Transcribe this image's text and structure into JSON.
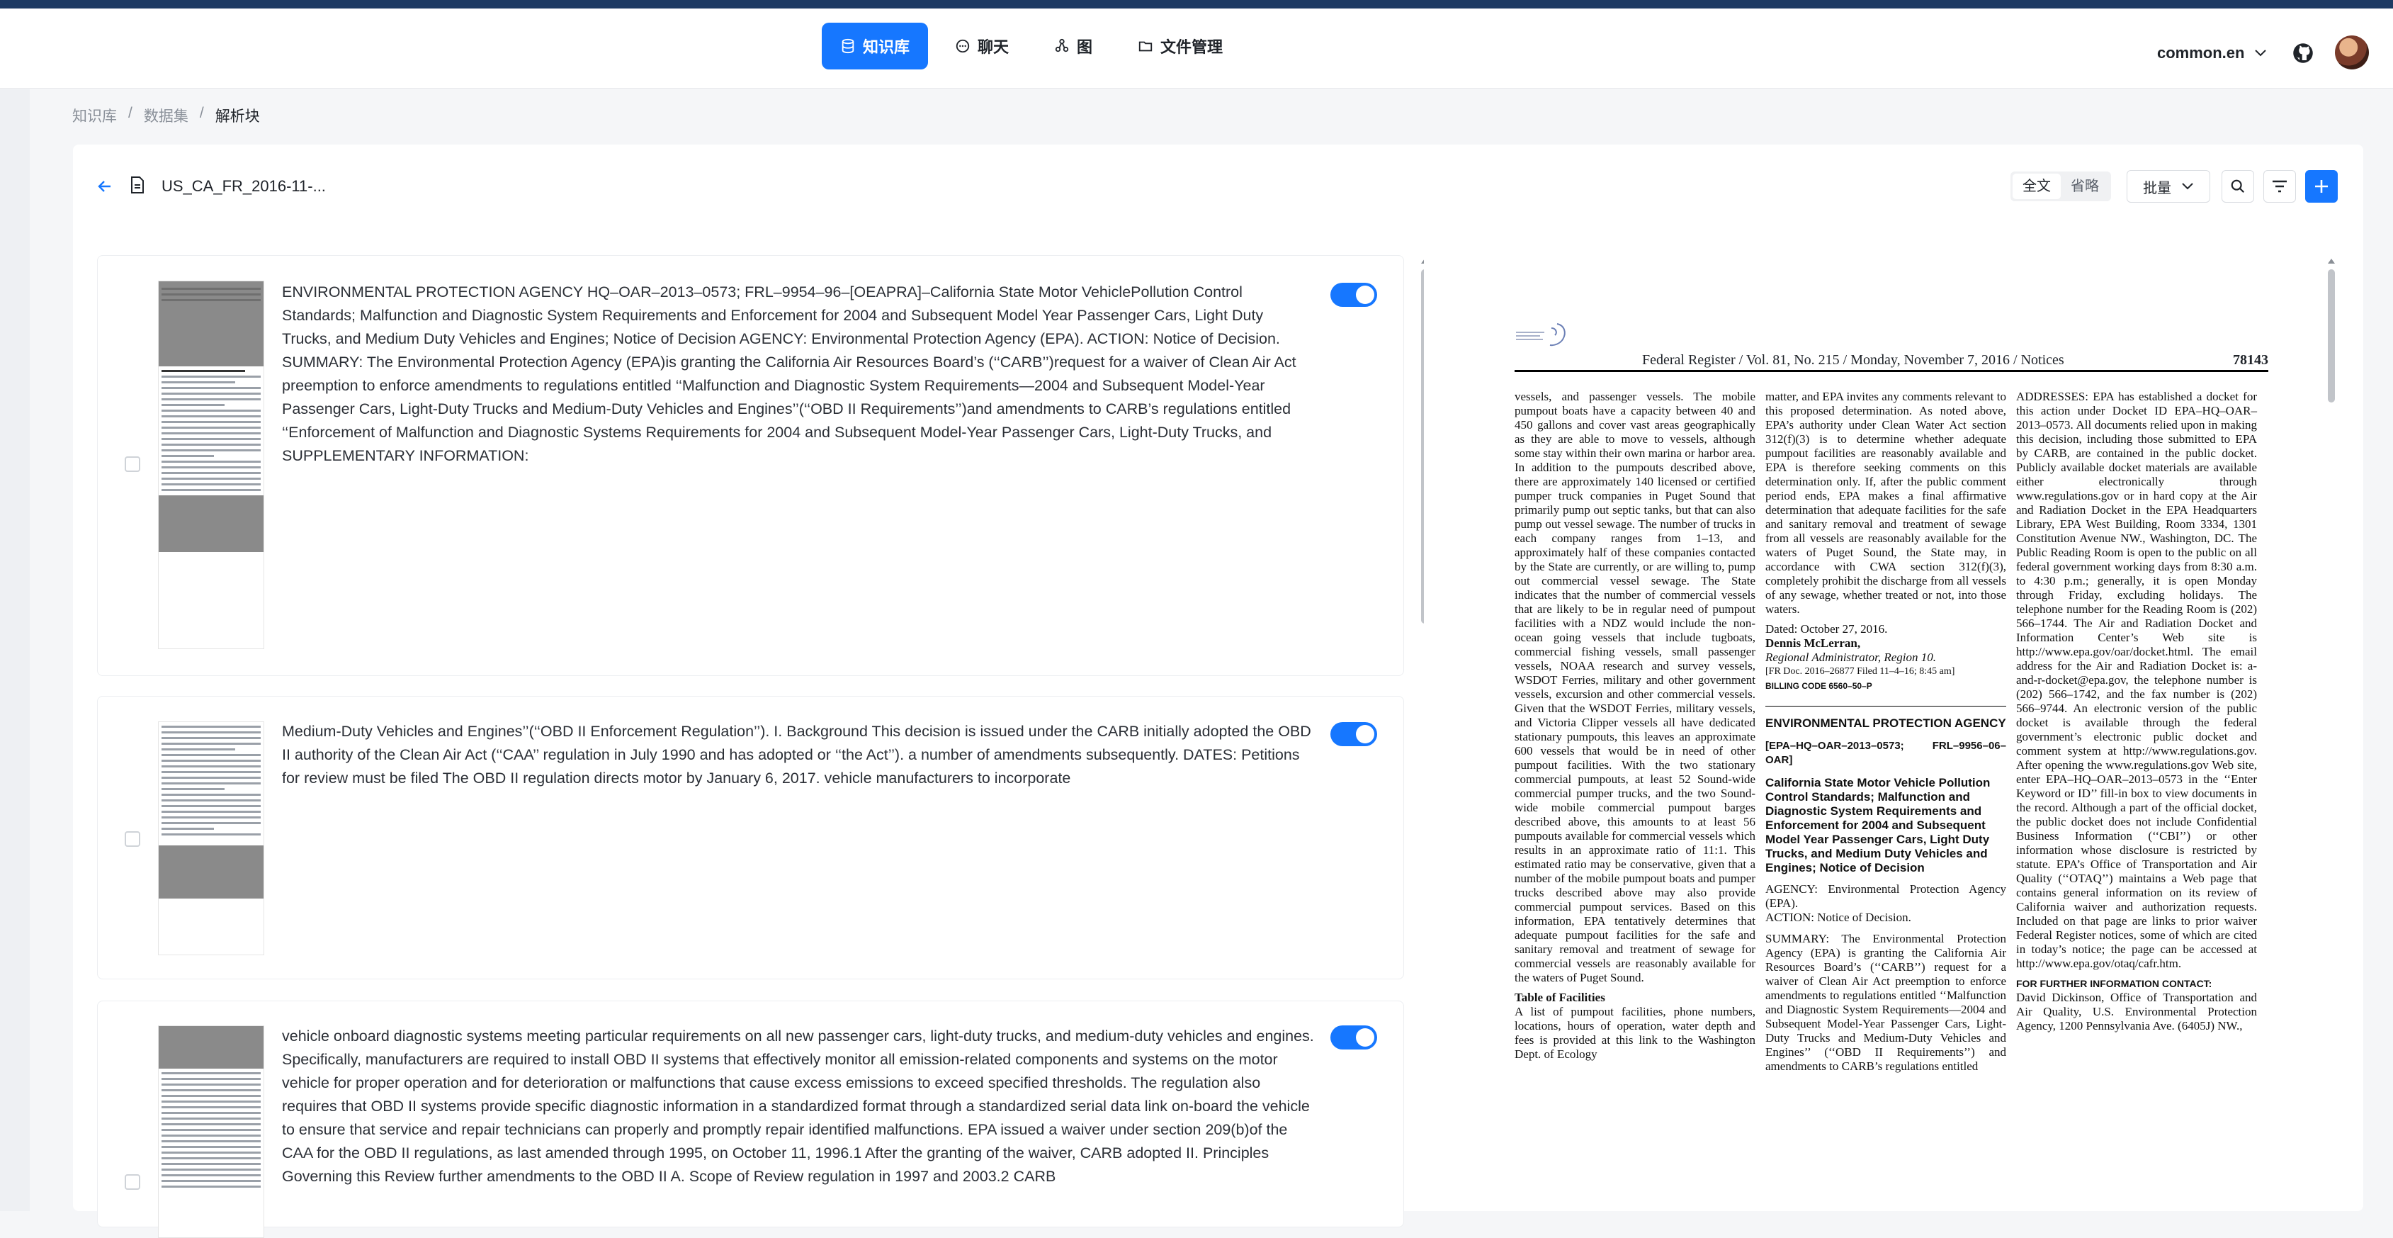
{
  "nav": {
    "items": [
      {
        "label": "知识库",
        "active": true
      },
      {
        "label": "聊天",
        "active": false
      },
      {
        "label": "图",
        "active": false
      },
      {
        "label": "文件管理",
        "active": false
      }
    ],
    "language": "common.en"
  },
  "breadcrumb": [
    "知识库",
    "数据集",
    "解析块"
  ],
  "header": {
    "file_title": "US_CA_FR_2016-11-...",
    "view_full": "全文",
    "view_ellipsis": "省略",
    "bulk_label": "批量"
  },
  "chunks": [
    {
      "text": "ENVIRONMENTAL PROTECTION AGENCY HQ–OAR–2013–0573; FRL–9954–96–[OEAPRA]–California State Motor VehiclePollution Control Standards; Malfunction and Diagnostic System Requirements and Enforcement for 2004 and Subsequent Model Year Passenger Cars, Light Duty Trucks, and Medium Duty Vehicles and Engines; Notice of Decision AGENCY: Environmental Protection Agency (EPA). ACTION: Notice of Decision. SUMMARY: The Environmental Protection Agency (EPA)is granting the California Air Resources Board’s (‘‘CARB’’)request for a waiver of Clean Air Act preemption to enforce amendments to regulations entitled ‘‘Malfunction and Diagnostic System Requirements—2004 and Subsequent Model-Year Passenger Cars, Light-Duty Trucks and Medium-Duty Vehicles and Engines’’(‘‘OBD II Requirements’’)and amendments to CARB’s regulations entitled ‘‘Enforcement of Malfunction and Diagnostic Systems Requirements for 2004 and Subsequent Model-Year Passenger Cars, Light-Duty Trucks, and SUPPLEMENTARY INFORMATION:",
      "enabled": true
    },
    {
      "text": "Medium-Duty Vehicles and Engines’’(‘‘OBD II Enforcement Regulation’’). I. Background This decision is issued under the CARB initially adopted the OBD II authority of the Clean Air Act (‘‘CAA’’ regulation in July 1990 and has adopted or ‘‘the Act’’). a number of amendments subsequently. DATES: Petitions for review must be filed The OBD II regulation directs motor by January 6, 2017. vehicle manufacturers to incorporate",
      "enabled": true
    },
    {
      "text": "vehicle onboard diagnostic systems meeting particular requirements on all new passenger cars, light-duty trucks, and medium-duty vehicles and engines. Specifically, manufacturers are required to install OBD II systems that effectively monitor all emission-related components and systems on the motor vehicle for proper operation and for deterioration or malfunctions that cause excess emissions to exceed specified thresholds. The regulation also requires that OBD II systems provide specific diagnostic information in a standardized format through a standardized serial data link on-board the vehicle to ensure that service and repair technicians can properly and promptly repair identified malfunctions. EPA issued a waiver under section 209(b)of the CAA for the OBD II regulations, as last amended through 1995, on October 11, 1996.1 After the granting of the waiver, CARB adopted II. Principles Governing this Review further amendments to the OBD II A. Scope of Review regulation in 1997 and 2003.2 CARB",
      "enabled": true
    }
  ],
  "pdf": {
    "running_head": "Federal Register / Vol. 81, No. 215 / Monday, November 7, 2016 / Notices",
    "page_number": "78143",
    "col1": "vessels, and passenger vessels. The mobile pumpout boats have a capacity between 40 and 450 gallons and cover vast areas geographically as they are able to move to vessels, although some stay within their own marina or harbor area. In addition to the pumpouts described above, there are approximately 140 licensed or certified pumper truck companies in Puget Sound that primarily pump out septic tanks, but that can also pump out vessel sewage. The number of trucks in each company ranges from 1–13, and approximately half of these companies contacted by the State are currently, or are willing to, pump out commercial vessel sewage. The State indicates that the number of commercial vessels that are likely to be in regular need of pumpout facilities with a NDZ would include the non-ocean going vessels that include tugboats, commercial fishing vessels, small passenger vessels, NOAA research and survey vessels, WSDOT Ferries, military and other government vessels, excursion and other commercial vessels. Given that the WSDOT Ferries, military vessels, and Victoria Clipper vessels all have dedicated stationary pumpouts, this leaves an approximate 600 vessels that would be in need of other pumpout facilities. With the two stationary commercial pumpouts, at least 52 Sound-wide commercial pumper trucks, and the two Sound-wide mobile commercial pumpout barges described above, this amounts to at least 56 pumpouts available for commercial vessels which results in an approximate ratio of 11:1. This estimated ratio may be conservative, given that a number of the mobile pumpout boats and pumper trucks described above may also provide commercial pumpout services. Based on this information, EPA tentatively determines that adequate pumpout facilities for the safe and sanitary removal and treatment of sewage for commercial vessels are reasonably available for the waters of Puget Sound.",
    "col1_heading": "Table of Facilities",
    "col1_tail": "A list of pumpout facilities, phone numbers, locations, hours of operation, water depth and fees is provided at this link to the Washington Dept. of Ecology",
    "col2": "matter, and EPA invites any comments relevant to this proposed determination. As noted above, EPA’s authority under Clean Water Act section 312(f)(3) is to determine whether adequate pumpout facilities are reasonably available and EPA is therefore seeking comments on this determination only. If, after the public comment period ends, EPA makes a final affirmative determination that adequate facilities for the safe and sanitary removal and treatment of sewage from all vessels are reasonably available for the waters of Puget Sound, the State may, in accordance with CWA section 312(f)(3), completely prohibit the discharge from all vessels of any sewage, whether treated or not, into those waters.",
    "col2_dated": "Dated: October 27, 2016.",
    "col2_name": "Dennis McLerran,",
    "col2_role": "Regional Administrator, Region 10.",
    "col2_frdoc": "[FR Doc. 2016–26877 Filed 11–4–16; 8:45 am]",
    "col2_billing": "BILLING CODE 6560–50–P",
    "col2_agency": "ENVIRONMENTAL PROTECTION AGENCY",
    "col2_docket": "[EPA–HQ–OAR–2013–0573; FRL–9956–06–OAR]",
    "col2_title": "California State Motor Vehicle Pollution Control Standards; Malfunction and Diagnostic System Requirements and Enforcement for 2004 and Subsequent Model Year Passenger Cars, Light Duty Trucks, and Medium Duty Vehicles and Engines; Notice of Decision",
    "col2_agency_line": "AGENCY: Environmental Protection Agency (EPA).",
    "col2_action": "ACTION: Notice of Decision.",
    "col2_summary": "SUMMARY: The Environmental Protection Agency (EPA) is granting the California Air Resources Board’s (‘‘CARB’’) request for a waiver of Clean Air Act preemption to enforce amendments to regulations entitled ‘‘Malfunction and Diagnostic System Requirements—2004 and Subsequent Model-Year Passenger Cars, Light-Duty Trucks and Medium-Duty Vehicles and Engines’’ (‘‘OBD II Requirements’’) and amendments to CARB’s regulations entitled",
    "col3": "ADDRESSES: EPA has established a docket for this action under Docket ID EPA–HQ–OAR–2013–0573. All documents relied upon in making this decision, including those submitted to EPA by CARB, are contained in the public docket. Publicly available docket materials are available either electronically through www.regulations.gov or in hard copy at the Air and Radiation Docket in the EPA Headquarters Library, EPA West Building, Room 3334, 1301 Constitution Avenue NW., Washington, DC. The Public Reading Room is open to the public on all federal government working days from 8:30 a.m. to 4:30 p.m.; generally, it is open Monday through Friday, excluding holidays. The telephone number for the Reading Room is (202) 566–1744. The Air and Radiation Docket and Information Center’s Web site is http://www.epa.gov/oar/docket.html. The email address for the Air and Radiation Docket is: a-and-r-docket@epa.gov, the telephone number is (202) 566–1742, and the fax number is (202) 566–9744. An electronic version of the public docket is available through the federal government’s electronic public docket and comment system at http://www.regulations.gov. After opening the www.regulations.gov Web site, enter EPA–HQ–OAR–2013–0573 in the ‘‘Enter Keyword or ID’’ fill-in box to view documents in the record. Although a part of the official docket, the public docket does not include Confidential Business Information (‘‘CBI’’) or other information whose disclosure is restricted by statute. EPA’s Office of Transportation and Air Quality (‘‘OTAQ’’) maintains a Web page that contains general information on its review of California waiver and authorization requests. Included on that page are links to prior waiver Federal Register notices, some of which are cited in today’s notice; the page can be accessed at http://www.epa.gov/otaq/cafr.htm.",
    "col3_contact": "FOR FURTHER INFORMATION CONTACT:",
    "col3_tail": "David Dickinson, Office of Transportation and Air Quality, U.S. Environmental Protection Agency, 1200 Pennsylvania Ave. (6405J) NW.,"
  }
}
